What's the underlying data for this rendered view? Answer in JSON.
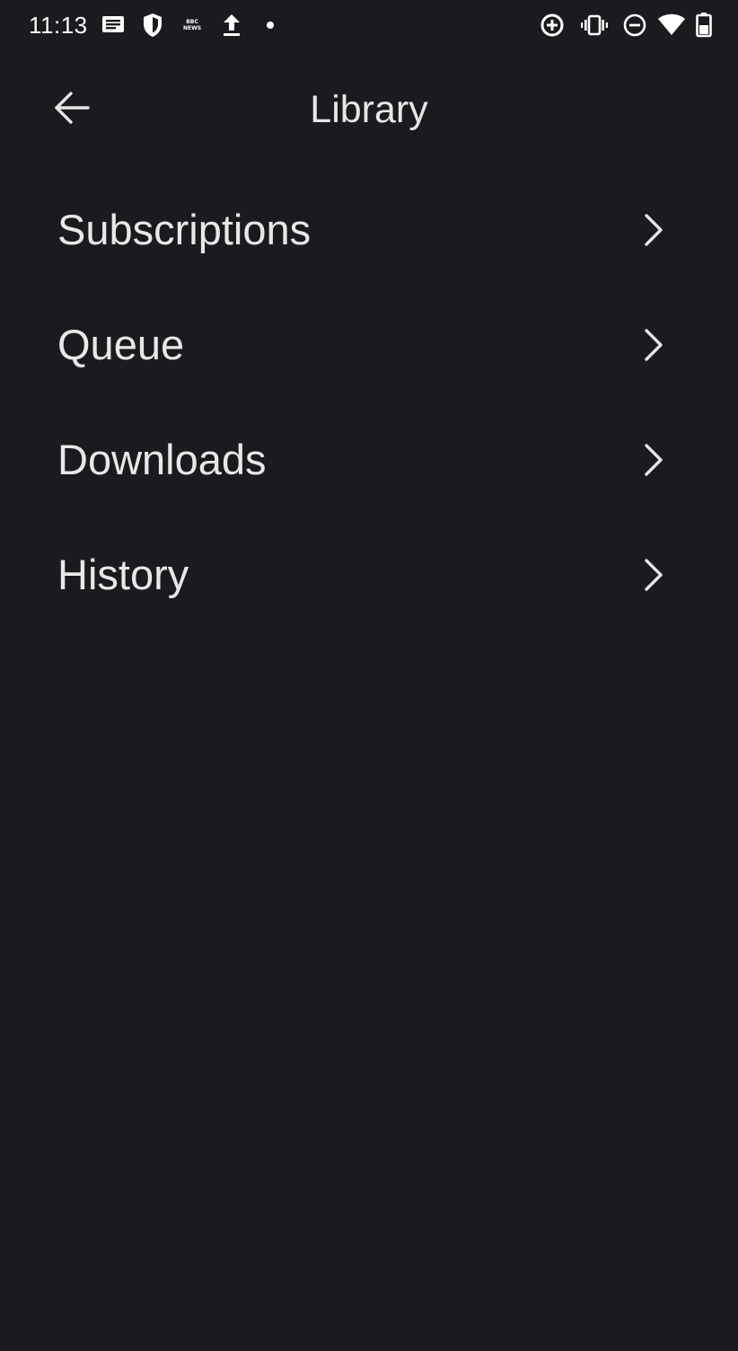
{
  "status_bar": {
    "time": "11:13",
    "left_icons": [
      "message-icon",
      "shield-icon",
      "bbc-news-icon",
      "upload-icon",
      "dot-icon"
    ],
    "bbc_top": "BBC",
    "bbc_bottom": "NEWS",
    "right_icons": [
      "data-saver-icon",
      "vibrate-icon",
      "do-not-disturb-icon",
      "wifi-icon",
      "battery-icon"
    ]
  },
  "app_bar": {
    "title": "Library",
    "back_icon": "arrow-left-icon"
  },
  "menu": {
    "items": [
      {
        "label": "Subscriptions",
        "icon": "chevron-right-icon"
      },
      {
        "label": "Queue",
        "icon": "chevron-right-icon"
      },
      {
        "label": "Downloads",
        "icon": "chevron-right-icon"
      },
      {
        "label": "History",
        "icon": "chevron-right-icon"
      }
    ]
  },
  "colors": {
    "background": "#1a1b1e",
    "text": "#e6e6e6",
    "icon": "#ffffff"
  }
}
